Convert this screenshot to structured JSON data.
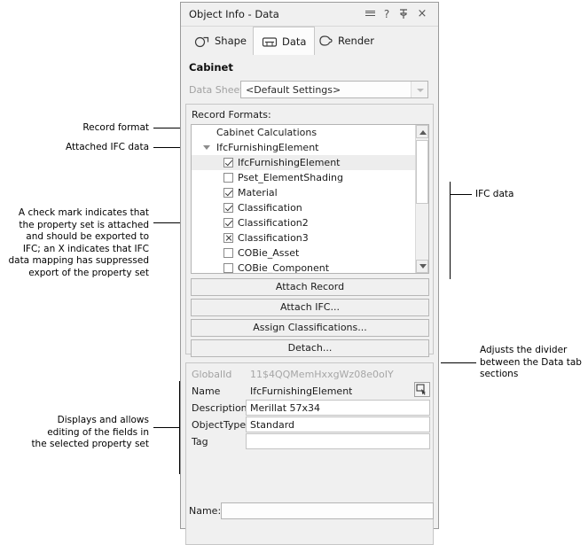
{
  "window": {
    "title": "Object Info - Data",
    "titlebar_buttons": [
      {
        "name": "menu-icon",
        "glyph": "≡"
      },
      {
        "name": "help-icon",
        "glyph": "?"
      },
      {
        "name": "pin-icon",
        "glyph": "⍇"
      },
      {
        "name": "close-icon",
        "glyph": "×"
      }
    ]
  },
  "tabs": [
    {
      "label": "Shape",
      "icon": "shape-icon",
      "active": false
    },
    {
      "label": "Data",
      "icon": "data-icon",
      "active": true
    },
    {
      "label": "Render",
      "icon": "render-icon",
      "active": false
    }
  ],
  "object": {
    "name": "Cabinet"
  },
  "data_sheet": {
    "label": "Data Sheet:",
    "value": "<Default Settings>"
  },
  "record_formats": {
    "label": "Record Formats:",
    "items": [
      {
        "text": "Cabinet Calculations",
        "level": 0,
        "checkbox": "none",
        "disclosure": "none",
        "selected": false
      },
      {
        "text": "IfcFurnishingElement",
        "level": 0,
        "checkbox": "none",
        "disclosure": "expanded",
        "selected": false
      },
      {
        "text": "IfcFurnishingElement",
        "level": 1,
        "checkbox": "checked",
        "disclosure": "none",
        "selected": true
      },
      {
        "text": "Pset_ElementShading",
        "level": 1,
        "checkbox": "unchecked",
        "disclosure": "none",
        "selected": false
      },
      {
        "text": "Material",
        "level": 1,
        "checkbox": "checked",
        "disclosure": "none",
        "selected": false
      },
      {
        "text": "Classification",
        "level": 1,
        "checkbox": "checked",
        "disclosure": "none",
        "selected": false
      },
      {
        "text": "Classification2",
        "level": 1,
        "checkbox": "checked",
        "disclosure": "none",
        "selected": false
      },
      {
        "text": "Classification3",
        "level": 1,
        "checkbox": "crossed",
        "disclosure": "none",
        "selected": false
      },
      {
        "text": "COBie_Asset",
        "level": 1,
        "checkbox": "unchecked",
        "disclosure": "none",
        "selected": false
      },
      {
        "text": "COBie_Component",
        "level": 1,
        "checkbox": "unchecked",
        "disclosure": "none",
        "selected": false
      }
    ]
  },
  "buttons": {
    "attach_record": "Attach Record",
    "attach_ifc": "Attach IFC...",
    "assign_classifications": "Assign Classifications...",
    "detach": "Detach..."
  },
  "property_fields": [
    {
      "label": "GlobalId",
      "value": "11$4QQMemHxxgWz08e0oIY",
      "readonly": true
    },
    {
      "label": "Name",
      "value": "IfcFurnishingElement",
      "readonly": true
    },
    {
      "label": "Description",
      "value": "Merillat 57x34",
      "readonly": false
    },
    {
      "label": "ObjectType",
      "value": "Standard",
      "readonly": false
    },
    {
      "label": "Tag",
      "value": "",
      "readonly": false
    }
  ],
  "bottom": {
    "name_label": "Name:",
    "name_value": ""
  },
  "annotations": [
    {
      "id": "record-format",
      "text": "Record format"
    },
    {
      "id": "attached-ifc-data",
      "text": "Attached IFC data"
    },
    {
      "id": "check-mark-note",
      "text": "A check mark indicates that\nthe property set is attached\nand should be exported to\nIFC; an X indicates that IFC\ndata mapping has suppressed\nexport of the property set"
    },
    {
      "id": "fields-note",
      "text": "Displays and allows\nediting of the fields in\nthe selected property set"
    },
    {
      "id": "ifc-data",
      "text": "IFC data"
    },
    {
      "id": "divider-note",
      "text": "Adjusts the divider\nbetween the Data tab\nsections"
    }
  ],
  "colors": {
    "window_bg": "#f0f0f0",
    "border": "#9a9a9a",
    "field_bg": "#ffffff",
    "muted_text": "#a2a2a2",
    "selection": "#ededed"
  }
}
